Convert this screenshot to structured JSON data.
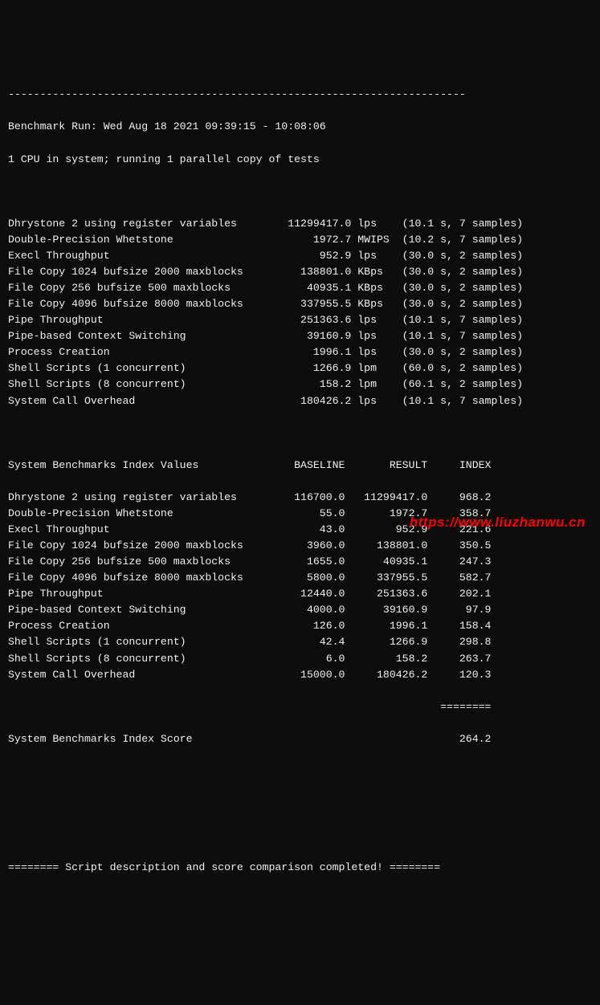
{
  "header": {
    "divider_top": "------------------------------------------------------------------------",
    "run_info": "Benchmark Run: Wed Aug 18 2021 09:39:15 - 10:08:06",
    "cpu_info": "1 CPU in system; running 1 parallel copy of tests"
  },
  "results": [
    {
      "name": "Dhrystone 2 using register variables",
      "value": "11299417.0",
      "unit": "lps",
      "timing": "(10.1 s, 7 samples)"
    },
    {
      "name": "Double-Precision Whetstone",
      "value": "1972.7",
      "unit": "MWIPS",
      "timing": "(10.2 s, 7 samples)"
    },
    {
      "name": "Execl Throughput",
      "value": "952.9",
      "unit": "lps",
      "timing": "(30.0 s, 2 samples)"
    },
    {
      "name": "File Copy 1024 bufsize 2000 maxblocks",
      "value": "138801.0",
      "unit": "KBps",
      "timing": "(30.0 s, 2 samples)"
    },
    {
      "name": "File Copy 256 bufsize 500 maxblocks",
      "value": "40935.1",
      "unit": "KBps",
      "timing": "(30.0 s, 2 samples)"
    },
    {
      "name": "File Copy 4096 bufsize 8000 maxblocks",
      "value": "337955.5",
      "unit": "KBps",
      "timing": "(30.0 s, 2 samples)"
    },
    {
      "name": "Pipe Throughput",
      "value": "251363.6",
      "unit": "lps",
      "timing": "(10.1 s, 7 samples)"
    },
    {
      "name": "Pipe-based Context Switching",
      "value": "39160.9",
      "unit": "lps",
      "timing": "(10.1 s, 7 samples)"
    },
    {
      "name": "Process Creation",
      "value": "1996.1",
      "unit": "lps",
      "timing": "(30.0 s, 2 samples)"
    },
    {
      "name": "Shell Scripts (1 concurrent)",
      "value": "1266.9",
      "unit": "lpm",
      "timing": "(60.0 s, 2 samples)"
    },
    {
      "name": "Shell Scripts (8 concurrent)",
      "value": "158.2",
      "unit": "lpm",
      "timing": "(60.1 s, 2 samples)"
    },
    {
      "name": "System Call Overhead",
      "value": "180426.2",
      "unit": "lps",
      "timing": "(10.1 s, 7 samples)"
    }
  ],
  "index_header": {
    "title": "System Benchmarks Index Values",
    "col_baseline": "BASELINE",
    "col_result": "RESULT",
    "col_index": "INDEX"
  },
  "index_rows": [
    {
      "name": "Dhrystone 2 using register variables",
      "baseline": "116700.0",
      "result": "11299417.0",
      "index": "968.2"
    },
    {
      "name": "Double-Precision Whetstone",
      "baseline": "55.0",
      "result": "1972.7",
      "index": "358.7"
    },
    {
      "name": "Execl Throughput",
      "baseline": "43.0",
      "result": "952.9",
      "index": "221.6"
    },
    {
      "name": "File Copy 1024 bufsize 2000 maxblocks",
      "baseline": "3960.0",
      "result": "138801.0",
      "index": "350.5"
    },
    {
      "name": "File Copy 256 bufsize 500 maxblocks",
      "baseline": "1655.0",
      "result": "40935.1",
      "index": "247.3"
    },
    {
      "name": "File Copy 4096 bufsize 8000 maxblocks",
      "baseline": "5800.0",
      "result": "337955.5",
      "index": "582.7"
    },
    {
      "name": "Pipe Throughput",
      "baseline": "12440.0",
      "result": "251363.6",
      "index": "202.1"
    },
    {
      "name": "Pipe-based Context Switching",
      "baseline": "4000.0",
      "result": "39160.9",
      "index": "97.9"
    },
    {
      "name": "Process Creation",
      "baseline": "126.0",
      "result": "1996.1",
      "index": "158.4"
    },
    {
      "name": "Shell Scripts (1 concurrent)",
      "baseline": "42.4",
      "result": "1266.9",
      "index": "298.8"
    },
    {
      "name": "Shell Scripts (8 concurrent)",
      "baseline": "6.0",
      "result": "158.2",
      "index": "263.7"
    },
    {
      "name": "System Call Overhead",
      "baseline": "15000.0",
      "result": "180426.2",
      "index": "120.3"
    }
  ],
  "score": {
    "divider": "========",
    "label": "System Benchmarks Index Score",
    "value": "264.2"
  },
  "footer": {
    "line": "======== Script description and score comparison completed! ========"
  },
  "watermark": "https://www.liuzhanwu.cn"
}
